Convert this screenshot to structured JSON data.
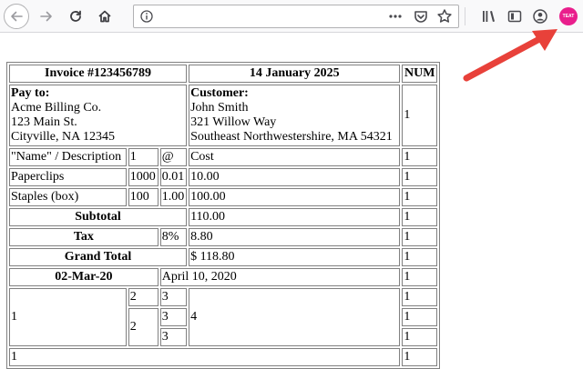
{
  "browser": {
    "url": "",
    "extension_badge": "TEAT",
    "colors": {
      "toolbar": "#f9f9fa",
      "annotation_arrow": "#e8413a",
      "extension": "#e91e8c"
    },
    "icons": [
      "back-arrow-icon",
      "forward-arrow-icon",
      "reload-icon",
      "home-icon",
      "info-icon",
      "more-dots-icon",
      "pocket-icon",
      "bookmark-star-icon",
      "library-icon",
      "sidebar-icon",
      "account-icon",
      "extension-icon"
    ]
  },
  "invoice": {
    "title": "Invoice #123456789",
    "date": "14 January 2025",
    "num_header": "NUM",
    "pay_to": {
      "label": "Pay to:",
      "lines": [
        "Acme Billing Co.",
        "123 Main St.",
        "Cityville, NA 12345"
      ]
    },
    "customer": {
      "label": "Customer:",
      "lines": [
        "John Smith",
        "321 Willow Way",
        "Southeast Northwestershire, MA 54321"
      ]
    },
    "header_num": "1",
    "columns": {
      "name": "\"Name\" / Description",
      "qty": "1",
      "at": "@",
      "cost": "Cost",
      "num": "1"
    },
    "items": [
      {
        "name": "Paperclips",
        "qty": "1000",
        "price": "0.01",
        "cost": "10.00",
        "num": "1"
      },
      {
        "name": "Staples (box)",
        "qty": "100",
        "price": "1.00",
        "cost": "100.00",
        "num": "1"
      }
    ],
    "subtotal": {
      "label": "Subtotal",
      "value": "110.00",
      "num": "1"
    },
    "tax": {
      "label": "Tax",
      "rate": "8%",
      "value": "8.80",
      "num": "1"
    },
    "grand_total": {
      "label": "Grand Total",
      "value": "$ 118.80",
      "num": "1"
    },
    "dates_row": {
      "left": "02-Mar-20",
      "right": "April 10, 2020",
      "num": "1"
    },
    "nested": {
      "a": "1",
      "b1": "2",
      "c1": "3",
      "b2": "2",
      "c2": "3",
      "c3": "3",
      "d": "4",
      "n1": "1",
      "n2": "1",
      "n3": "1"
    },
    "footer": {
      "left": "1",
      "num": "1"
    }
  }
}
